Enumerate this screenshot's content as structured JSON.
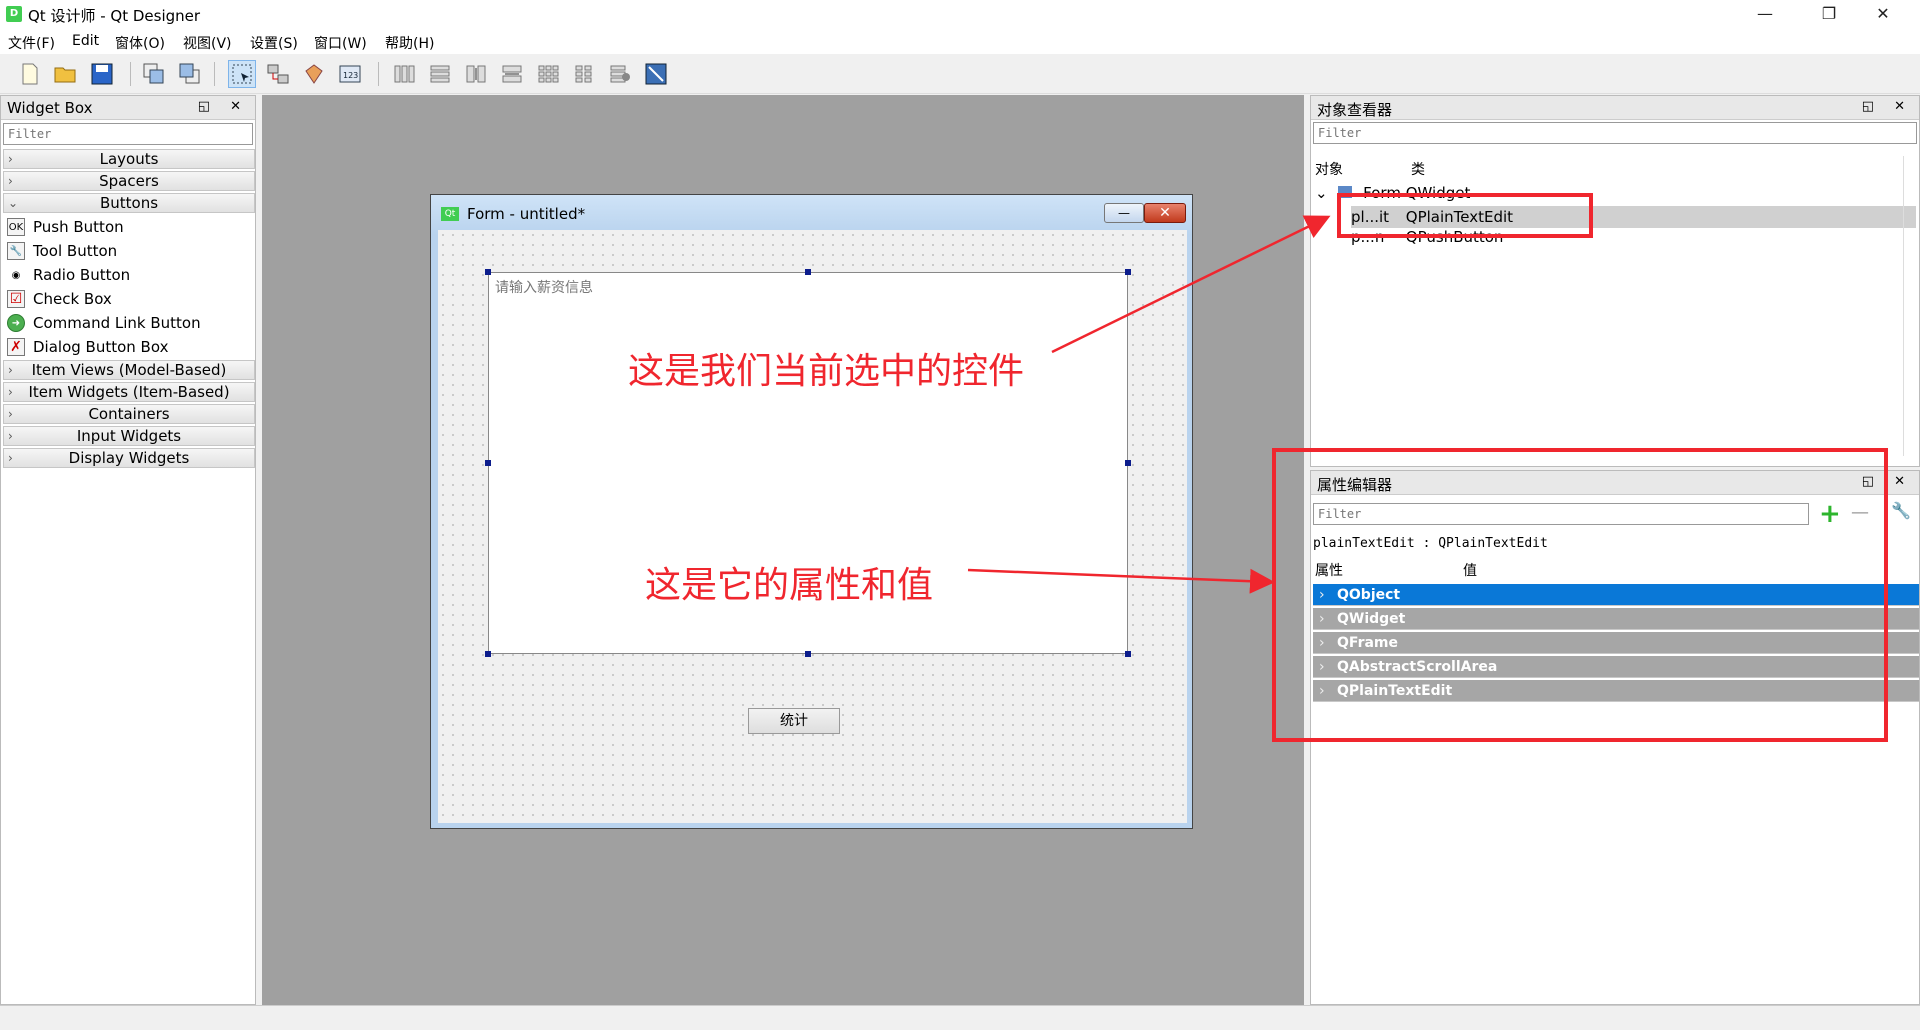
{
  "window": {
    "title": "Qt 设计师 - Qt Designer",
    "icon_text": "D",
    "min": "—",
    "max": "❐",
    "close": "✕"
  },
  "menu": [
    "文件(F)",
    "Edit",
    "窗体(O)",
    "视图(V)",
    "设置(S)",
    "窗口(W)",
    "帮助(H)"
  ],
  "widget_box": {
    "title": "Widget Box",
    "dock_buttons": "◱ ✕",
    "filter_placeholder": "Filter",
    "categories": {
      "layouts": "Layouts",
      "spacers": "Spacers",
      "buttons": "Buttons",
      "item_views": "Item Views (Model-Based)",
      "item_widgets": "Item Widgets (Item-Based)",
      "containers": "Containers",
      "input_widgets": "Input Widgets",
      "display_widgets": "Display Widgets"
    },
    "button_items": [
      "Push Button",
      "Tool Button",
      "Radio Button",
      "Check Box",
      "Command Link Button",
      "Dialog Button Box"
    ],
    "button_icons": [
      "OK",
      "🔧",
      "◉",
      "☑",
      "➜",
      "✗"
    ]
  },
  "form": {
    "icon_text": "Qt",
    "title": "Form - untitled*",
    "plaintext_placeholder": "请输入薪资信息",
    "button_label": "统计",
    "min": "—",
    "close": "✕"
  },
  "object_inspector": {
    "title": "对象查看器",
    "dock_buttons": "◱ ✕",
    "filter_placeholder": "Filter",
    "col_object": "对象",
    "col_class": "类",
    "rows": [
      {
        "name": "Form",
        "class": "QWidget"
      },
      {
        "name": "pl...it",
        "class": "QPlainTextEdit"
      },
      {
        "name": "p...n",
        "class": "QPushButton"
      }
    ]
  },
  "property_editor": {
    "title": "属性编辑器",
    "dock_buttons": "◱ ✕",
    "filter_placeholder": "Filter",
    "object_line": "plainTextEdit : QPlainTextEdit",
    "col_property": "属性",
    "col_value": "值",
    "groups": [
      "QObject",
      "QWidget",
      "QFrame",
      "QAbstractScrollArea",
      "QPlainTextEdit"
    ],
    "add": "+",
    "remove": "—",
    "config": "🔧"
  },
  "annotations": {
    "selected": "这是我们当前选中的控件",
    "props": "这是它的属性和值"
  },
  "colors": {
    "accent_red": "#f0262e",
    "selection_blue": "#0a78d7"
  }
}
